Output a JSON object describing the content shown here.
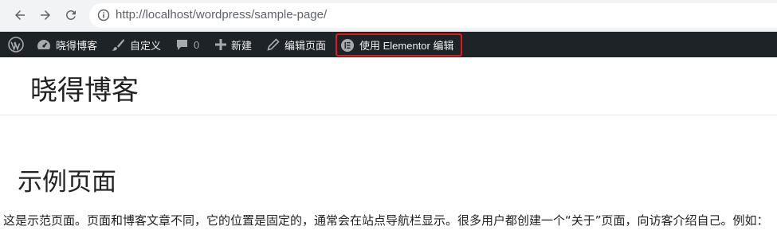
{
  "browser": {
    "url": "http://localhost/wordpress/sample-page/",
    "back_icon": "arrow-left-icon",
    "forward_icon": "arrow-right-icon",
    "reload_icon": "reload-icon",
    "info_icon": "info-circle-icon"
  },
  "admin_bar": {
    "wp_logo_icon": "wordpress-logo-icon",
    "site_name": "晓得博客",
    "customize": "自定义",
    "comments_count": "0",
    "new": "新建",
    "edit_page": "编辑页面",
    "edit_with_elementor": "使用 Elementor 编辑",
    "background_color": "#1d2327",
    "highlight_color": "#e01b1b"
  },
  "site": {
    "title": "晓得博客"
  },
  "page": {
    "title": "示例页面",
    "body": "这是示范页面。页面和博客文章不同，它的位置是固定的，通常会在站点导航栏显示。很多用户都创建一个“关于”页面，向访客介绍自己。例如："
  }
}
